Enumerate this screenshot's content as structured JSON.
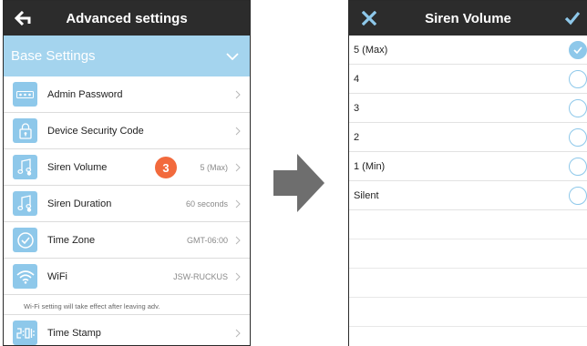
{
  "left_screen": {
    "title": "Advanced settings",
    "section": "Base Settings",
    "items": [
      {
        "label": "Admin Password",
        "value": "",
        "icon": "password-dots-icon"
      },
      {
        "label": "Device Security Code",
        "value": "",
        "icon": "lock-icon"
      },
      {
        "label": "Siren Volume",
        "value": "5 (Max)",
        "icon": "music-note-icon"
      },
      {
        "label": "Siren Duration",
        "value": "60 seconds",
        "icon": "music-note-icon"
      },
      {
        "label": "Time Zone",
        "value": "GMT-06:00",
        "icon": "clock-check-icon"
      },
      {
        "label": "WiFi",
        "value": "JSW-RUCKUS",
        "icon": "wifi-icon"
      },
      {
        "label": "Time Stamp",
        "value": "",
        "icon": "digital-clock-icon"
      }
    ],
    "wifi_note": "Wi-Fi setting will take effect after leaving adv.",
    "step_badge": "3"
  },
  "right_screen": {
    "title": "Siren Volume",
    "options": [
      {
        "label": "5 (Max)",
        "selected": true
      },
      {
        "label": "4",
        "selected": false
      },
      {
        "label": "3",
        "selected": false
      },
      {
        "label": "2",
        "selected": false
      },
      {
        "label": "1 (Min)",
        "selected": false
      },
      {
        "label": "Silent",
        "selected": false
      }
    ],
    "selected_index": 0
  },
  "colors": {
    "titlebar": "#2c2c2c",
    "section_header": "#a4d4ee",
    "icon_tile": "#8ec8ea",
    "badge": "#f26a3d",
    "step_arrow": "#6e6e6e"
  }
}
